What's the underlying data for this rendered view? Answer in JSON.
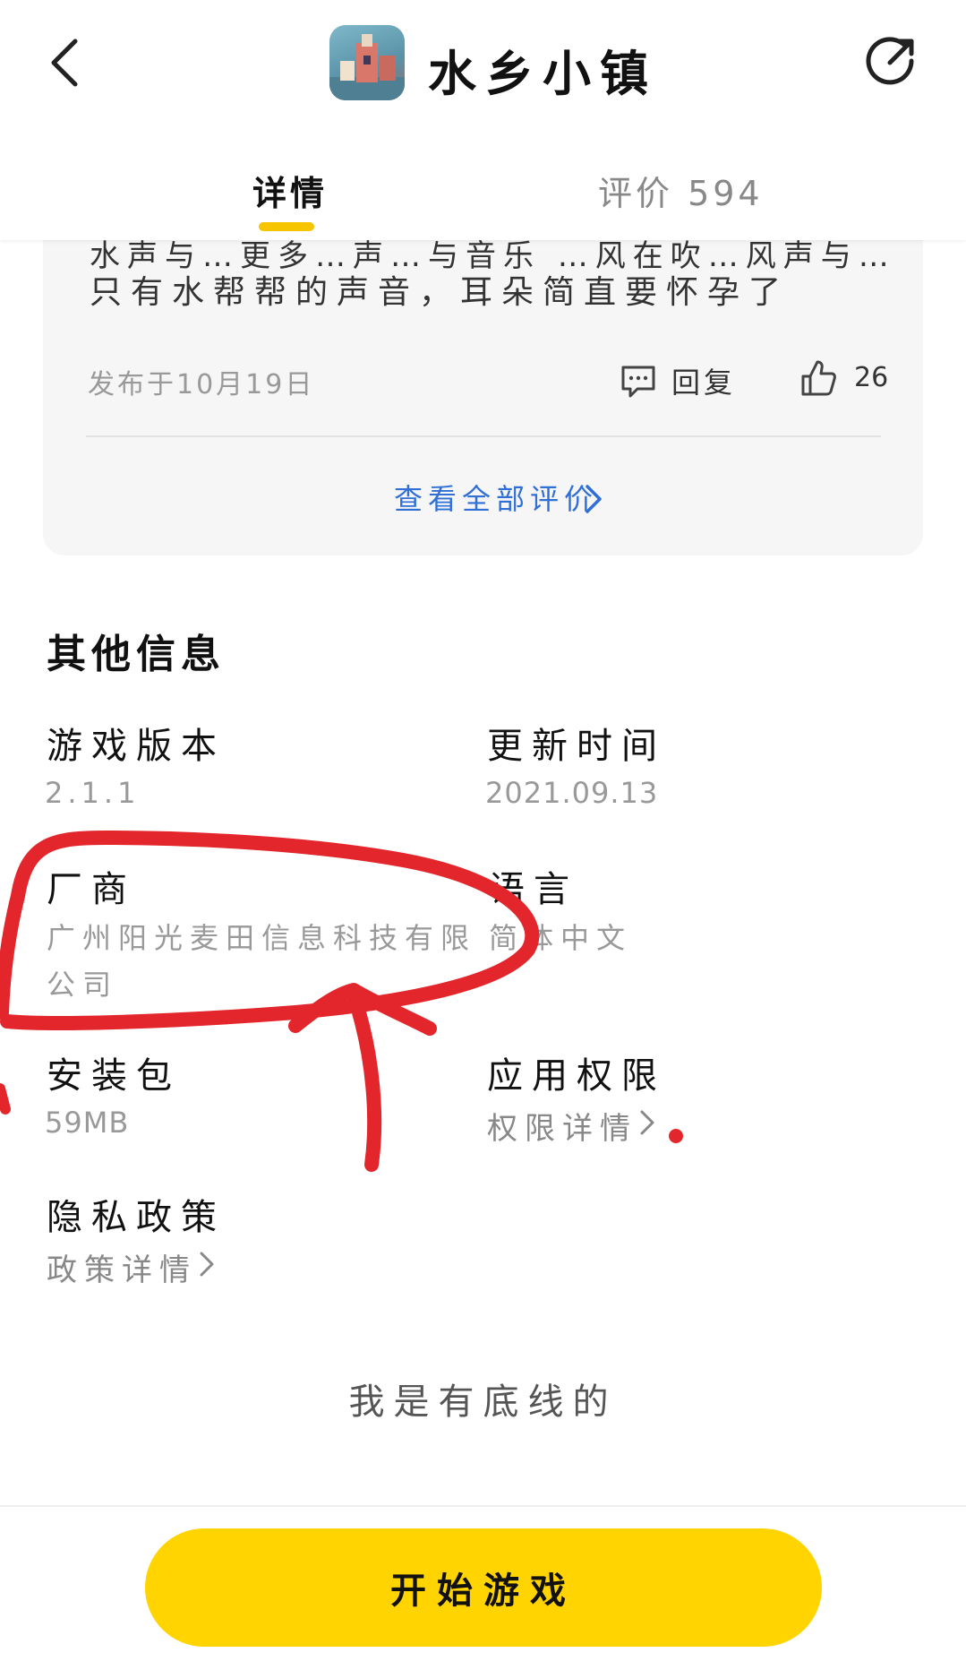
{
  "header": {
    "app_title": "水乡小镇",
    "back_icon": "back-chevron-icon",
    "share_icon": "share-icon",
    "tabs": [
      {
        "label": "详情",
        "active": true
      },
      {
        "label": "评价 594",
        "active": false
      }
    ]
  },
  "review": {
    "cut_line": "水声与…更多…声…与音乐 …风在吹…风声与…",
    "text": "只有水帮帮的声音，耳朵简直要怀孕了",
    "published": "发布于10月19日",
    "reply_label": "回复",
    "likes": "26",
    "view_all": "查看全部评价"
  },
  "other_info": {
    "title": "其他信息",
    "version_label": "游戏版本",
    "version_value": "2.1.1",
    "update_label": "更新时间",
    "update_value": "2021.09.13",
    "vendor_label": "厂商",
    "vendor_value_line1": "广州阳光麦田信息科技有限",
    "vendor_value_line2": "公司",
    "language_label": "语言",
    "language_value": "简体中文",
    "package_label": "安装包",
    "package_value": "59MB",
    "permission_label": "应用权限",
    "permission_link": "权限详情",
    "privacy_label": "隐私政策",
    "privacy_link": "政策详情"
  },
  "footer": {
    "bottom_text": "我是有底线的",
    "start_button": "开始游戏"
  },
  "colors": {
    "accent_yellow": "#ffd400",
    "tab_underline": "#f6c500",
    "link_blue": "#2f6fd6",
    "annotation_red": "#e3262c"
  }
}
